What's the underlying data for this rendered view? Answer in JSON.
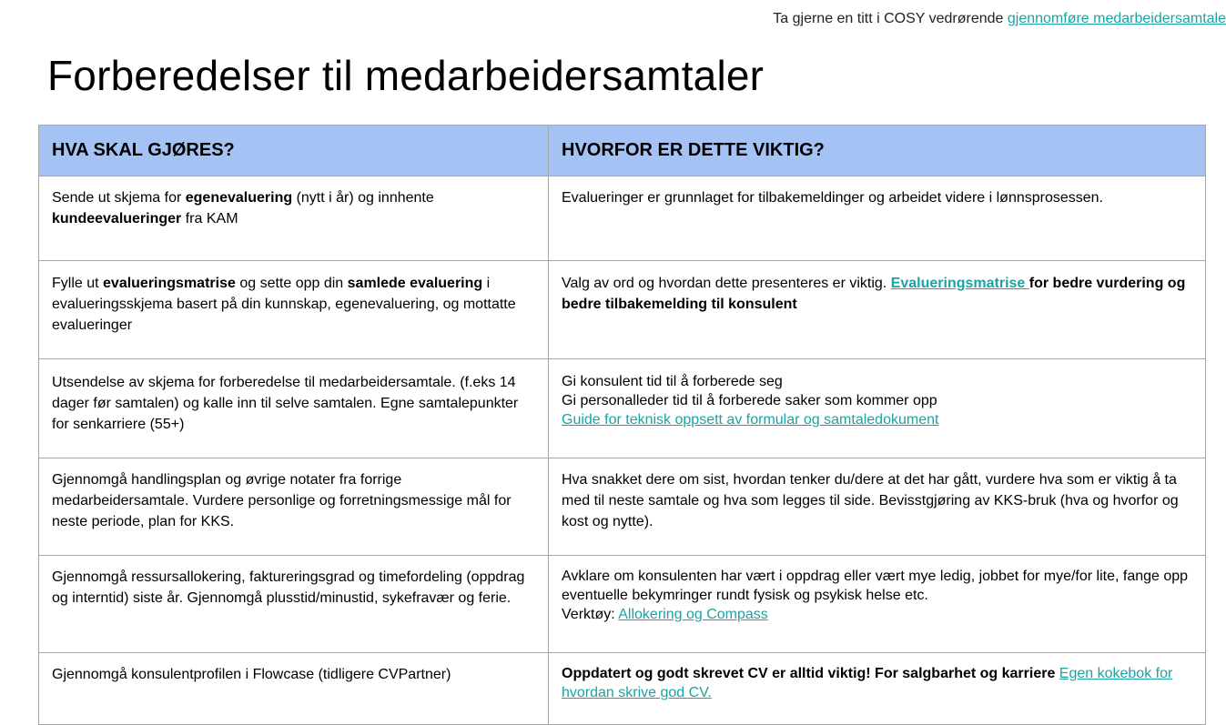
{
  "top_note": {
    "text": "Ta gjerne en titt i COSY vedrørende ",
    "link": "gjennomføre medarbeidersamtale"
  },
  "title": "Forberedelser til medarbeidersamtaler",
  "table": {
    "headers": [
      "HVA SKAL GJØRES?",
      "HVORFOR ER DETTE VIKTIG?"
    ],
    "rows": [
      {
        "left": {
          "t1": "Sende ut skjema for ",
          "b1": "egenevaluering",
          "t2": " (nytt i år) og innhente ",
          "b2": "kundeevalueringer",
          "t3": " fra KAM"
        },
        "right": {
          "t1": "Evalueringer er grunnlaget for tilbakemeldinger og arbeidet videre i lønnsprosessen."
        }
      },
      {
        "left": {
          "t1": "Fylle ut ",
          "b1": "evalueringsmatrise",
          "t2": " og sette opp din ",
          "b2": "samlede evaluering",
          "t3": " i evalueringsskjema basert på din kunnskap, egenevaluering, og mottatte evalueringer"
        },
        "right": {
          "t1": "Valg av ord og hvordan dette presenteres er viktig. ",
          "link": "Evalueringsmatrise ",
          "b1": "for bedre vurdering og bedre tilbakemelding til konsulent"
        }
      },
      {
        "left": {
          "t1": "Utsendelse av skjema for forberedelse til medarbeidersamtale. (f.eks 14 dager før samtalen) og kalle inn til selve samtalen. Egne samtalepunkter for senkarriere (55+)"
        },
        "right": {
          "line1": "Gi konsulent tid til å forberede seg",
          "line2": "Gi personalleder tid til å forberede saker som kommer opp",
          "link": "Guide for teknisk oppsett av formular og samtaledokument"
        }
      },
      {
        "left": {
          "t1": "Gjennomgå handlingsplan og øvrige notater fra forrige medarbeidersamtale. Vurdere personlige og forretningsmessige mål for neste periode, plan for KKS."
        },
        "right": {
          "t1": "Hva snakket dere om sist, hvordan tenker du/dere at det har gått, vurdere hva som er viktig å ta med til neste samtale og hva som legges til side. Bevisstgjøring av KKS-bruk (hva og hvorfor og kost og nytte)."
        }
      },
      {
        "left": {
          "t1": "Gjennomgå ressursallokering, faktureringsgrad og timefordeling (oppdrag og interntid) siste år. Gjennomgå plusstid/minustid, sykefravær og ferie."
        },
        "right": {
          "line1": "Avklare om konsulenten har vært i oppdrag eller vært mye ledig, jobbet for mye/for lite, fange opp eventuelle bekymringer rundt fysisk og psykisk helse etc.",
          "prefix": "Verktøy: ",
          "link": "Allokering og Compass"
        }
      },
      {
        "left": {
          "t1": "Gjennomgå konsulentprofilen i Flowcase (tidligere CVPartner)"
        },
        "right": {
          "b1": "Oppdatert og godt skrevet CV er alltid viktig! For salgbarhet og karriere",
          "link": "Egen kokebok for hvordan skrive god CV."
        }
      }
    ]
  }
}
